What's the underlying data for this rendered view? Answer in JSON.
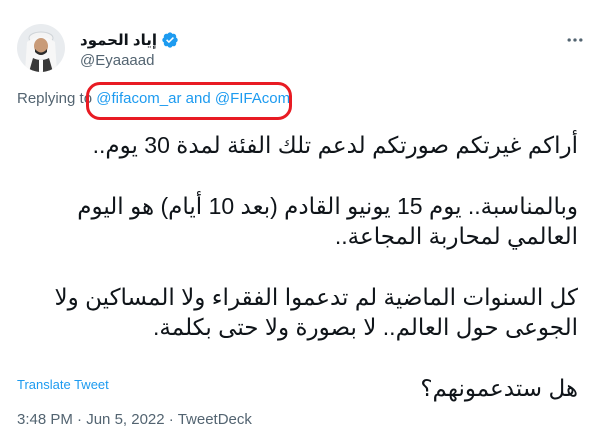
{
  "author": {
    "display_name": "إياد الحمود",
    "handle": "@Eyaaaad",
    "verified_icon": "verified-badge-icon",
    "accent_color": "#1d9bf0"
  },
  "reply_context": {
    "prefix": "Replying to",
    "mention_1": "@fifacom_ar",
    "conjunction": "and",
    "mention_2": "@FIFAcom",
    "highlight_color": "#e81b23"
  },
  "tweet": {
    "line_1": "أراكم غيرتكم صورتكم لدعم تلك الفئة لمدة 30 يوم..",
    "line_2": "وبالمناسبة.. يوم 15 يونيو القادم (بعد 10 أيام) هو اليوم العالمي لمحاربة المجاعة..",
    "line_3": "كل السنوات الماضية لم تدعموا الفقراء ولا المساكين ولا الجوعى حول العالم.. لا بصورة ولا حتى بكلمة.",
    "line_4": "هل ستدعمونهم؟"
  },
  "translate_label": "Translate Tweet",
  "meta": {
    "time": "3:48 PM",
    "separator_1": "·",
    "date": "Jun 5, 2022",
    "separator_2": "·",
    "source": "TweetDeck"
  },
  "icons": {
    "more": "more-options-icon"
  }
}
